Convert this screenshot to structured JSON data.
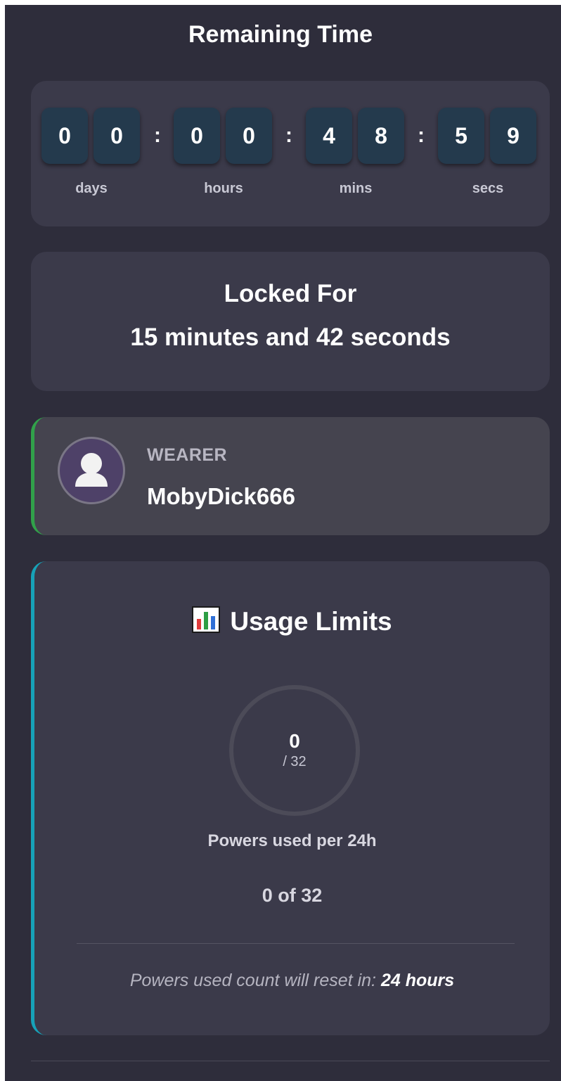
{
  "header": {
    "title": "Remaining Time"
  },
  "countdown": {
    "digits": [
      "0",
      "0",
      "0",
      "0",
      "4",
      "8",
      "5",
      "9"
    ],
    "separator": ":",
    "units": [
      "days",
      "hours",
      "mins",
      "secs"
    ]
  },
  "locked": {
    "title": "Locked For",
    "value": "15 minutes and 42 seconds"
  },
  "wearer": {
    "label": "WEARER",
    "name": "MobyDick666",
    "accent_color": "#31a14a",
    "avatar_icon": "user-silhouette-icon"
  },
  "usage": {
    "icon": "bar-chart-icon",
    "title": "Usage Limits",
    "ring_value": "0",
    "ring_total": "/ 32",
    "used_fraction": 0,
    "label": "Powers used per 24h",
    "count_text": "0 of 32",
    "reset_prefix": "Powers used count will reset in:",
    "reset_value": "24 hours",
    "accent_color": "#17a2b8"
  }
}
